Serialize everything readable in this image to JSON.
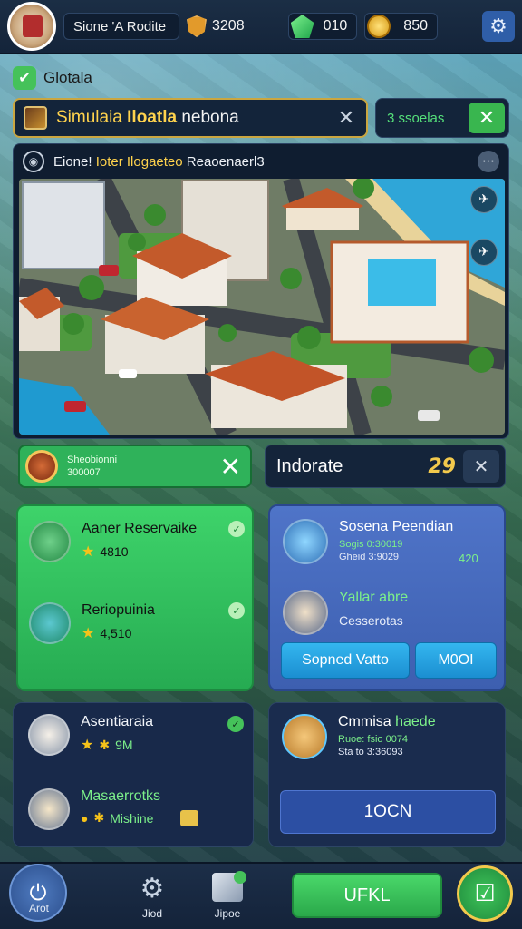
{
  "header": {
    "player_name": "Sione 'A Rodite",
    "shield_value": "3208",
    "gem_value": "010",
    "coin_value": "850"
  },
  "mini_label": {
    "text": "Glotala"
  },
  "title_bar": {
    "text_plain": "Simulaia ",
    "text_bold": "Iloatla",
    "text_tail": " nebona",
    "score_text": "3 ssoelas"
  },
  "map_header": {
    "prefix": "Eione! ",
    "highlight": "Ioter Ilogaeteo",
    "suffix": " Reaoenaerl3"
  },
  "bar_left": {
    "line1": "Sheobionni",
    "line2": "300007"
  },
  "bar_right": {
    "label": "Indorate",
    "value": "29"
  },
  "green_card": {
    "item1": {
      "title": "Aaner Reservaike",
      "value": "4810"
    },
    "item2": {
      "title": "Reriopuinia",
      "value": "4,510"
    }
  },
  "blue_card": {
    "title": "Sosena Peendian",
    "sub": "Sogis 0:30019",
    "sub2": "Gheid 3:9029",
    "side_value": "420",
    "item2_title": "Yallar abre",
    "item2_sub": "Cesserotas",
    "btn1": "Sopned Vatto",
    "btn2": "M0OI"
  },
  "dark_card1": {
    "item1": {
      "title": "Asentiaraia",
      "value": "9M"
    },
    "item2": {
      "title": "Masaerrotks",
      "value": "Mishine"
    }
  },
  "dark_card2": {
    "title_plain": "Cmmisa ",
    "title_green": "haede",
    "sub": "Ruoe: fsio 0074",
    "sub2": "Sta to 3:36093",
    "btn": "1OCN"
  },
  "bottom_nav": {
    "left_label": "Arot",
    "nav2_label": "Jiod",
    "nav3_label": "Jipoe",
    "ok_label": "UFKL"
  }
}
